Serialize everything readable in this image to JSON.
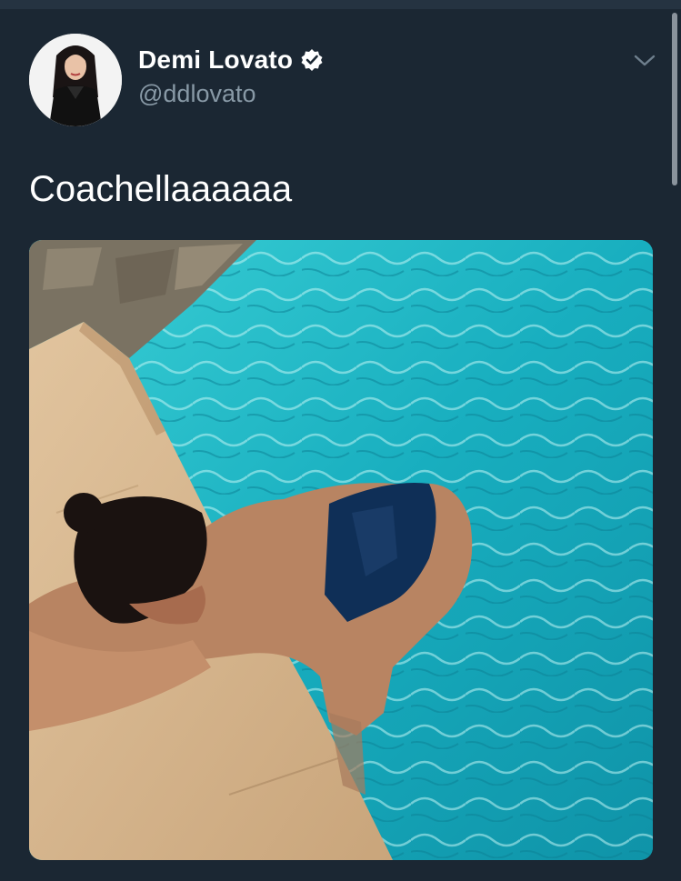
{
  "tweet": {
    "author": {
      "display_name": "Demi Lovato",
      "handle": "@ddlovato",
      "verified": true,
      "avatar_icon": "profile-photo"
    },
    "text": "Coachellaaaaaa",
    "media": {
      "kind": "photo",
      "icon": "photo"
    },
    "menu_icon": "chevron-down-icon"
  },
  "colors": {
    "background": "#1b2733",
    "text_primary": "#ffffff",
    "text_secondary": "#8899a6",
    "pool_water": "#1bb6c4",
    "pool_deck": "#d7b78d"
  }
}
